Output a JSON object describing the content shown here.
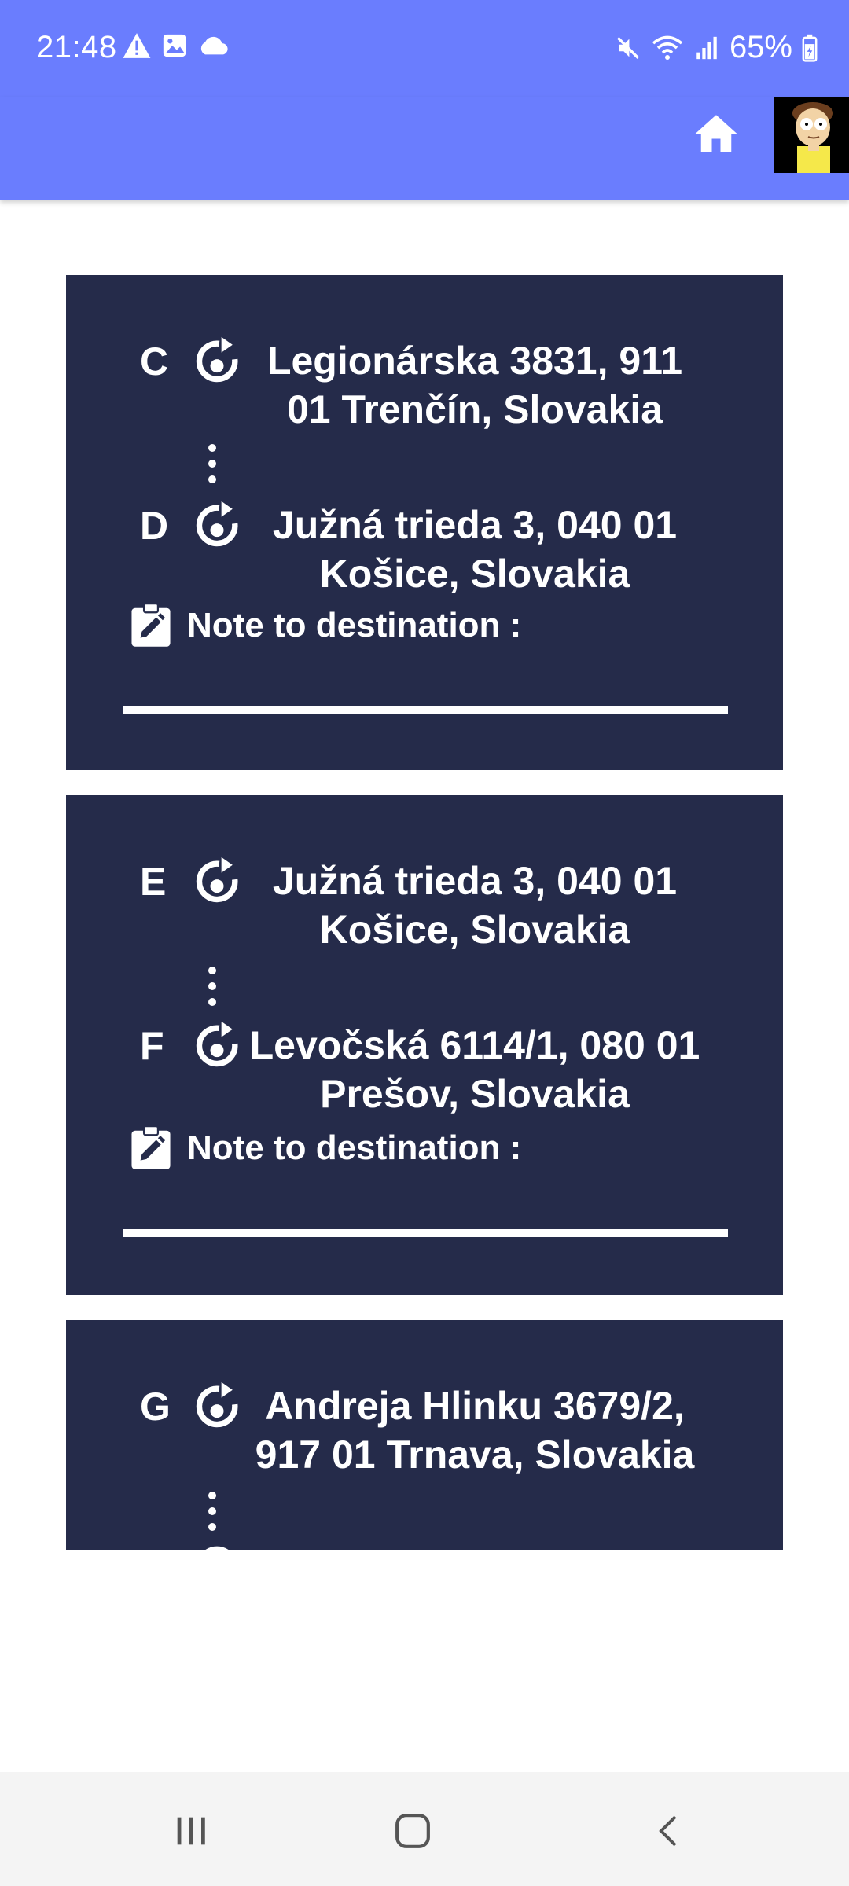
{
  "status_bar": {
    "time": "21:48",
    "battery": "65%",
    "icons_left": [
      "alert-icon",
      "image-icon",
      "cloud-icon"
    ],
    "icons_right": [
      "mute-icon",
      "wifi-icon",
      "signal-icon",
      "battery-charging-icon"
    ]
  },
  "app_bar": {
    "color": "#6a7dfe",
    "home_icon": "home-icon",
    "avatar_icon": "avatar-icon"
  },
  "cards": [
    {
      "stops": [
        {
          "letter": "C",
          "address_line1": "Legionárska 3831, 911",
          "address_line2": "01 Trenčín, Slovakia"
        },
        {
          "letter": "D",
          "address_line1": "Južná trieda 3, 040 01",
          "address_line2": "Košice, Slovakia"
        }
      ],
      "note_label": "Note to destination :"
    },
    {
      "stops": [
        {
          "letter": "E",
          "address_line1": "Južná trieda 3, 040 01",
          "address_line2": "Košice, Slovakia"
        },
        {
          "letter": "F",
          "address_line1": "Levočská 6114/1, 080 01",
          "address_line2": "Prešov, Slovakia"
        }
      ],
      "note_label": "Note to destination :"
    },
    {
      "stops": [
        {
          "letter": "G",
          "address_line1": "Andreja Hlinku 3679/2,",
          "address_line2": "917 01 Trnava, Slovakia"
        }
      ]
    }
  ],
  "card_color": "#252b4a",
  "nav_bar": {
    "recents_icon": "recents-icon",
    "home_icon": "home-circle-icon",
    "back_icon": "back-icon"
  }
}
